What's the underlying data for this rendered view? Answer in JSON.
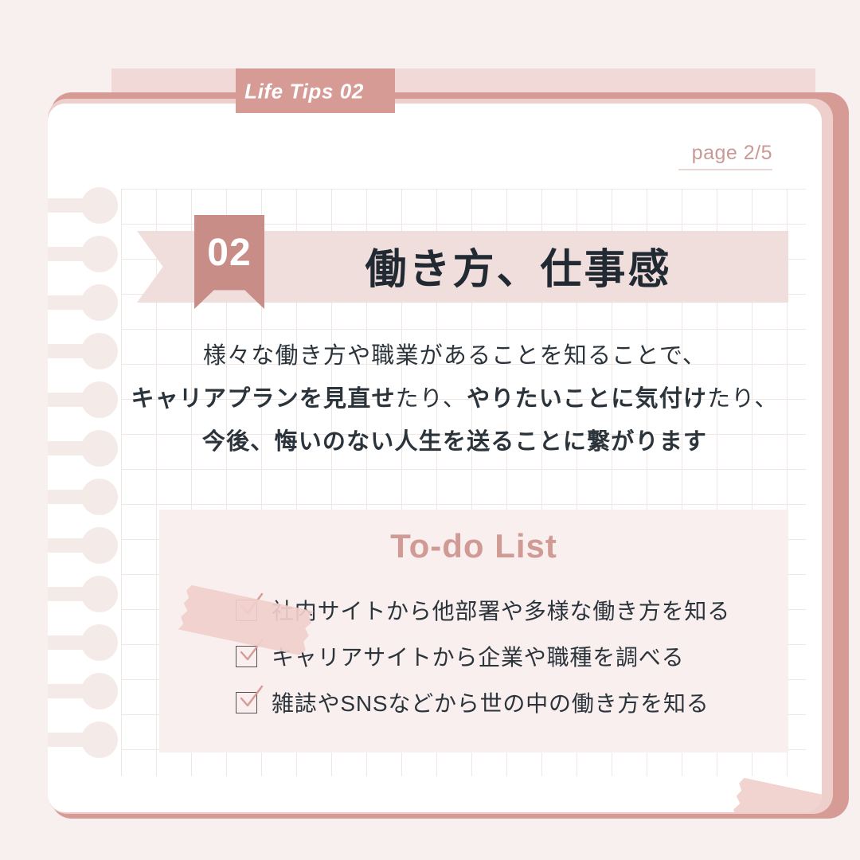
{
  "theme": {
    "background": "#f8f0ef",
    "card": "#ffffff",
    "accent_dark": "#d79b96",
    "accent_mid": "#c98d88",
    "accent_light": "#f0d9d6",
    "ribbon": "#f0dedc",
    "panel": "#f9efee",
    "tape": "#f0cfcb",
    "text_dark": "#2b333b",
    "grid_line": "#eee3e1"
  },
  "tabs": [
    {
      "label": "",
      "active": false
    },
    {
      "label": "Life Tips 02",
      "active": true
    },
    {
      "label": "",
      "active": false
    },
    {
      "label": "",
      "active": false
    },
    {
      "label": "",
      "active": false
    }
  ],
  "header": {
    "page_indicator": "page 2/5"
  },
  "ribbon": {
    "number": "02",
    "title": "働き方、仕事感"
  },
  "body": {
    "lines": [
      [
        {
          "text": "様々な働き方や職業があることを知ることで、",
          "bold": false
        }
      ],
      [
        {
          "text": "キャリアプランを見直せ",
          "bold": true
        },
        {
          "text": "たり、",
          "bold": false
        },
        {
          "text": "やりたいことに気付け",
          "bold": true
        },
        {
          "text": "たり、",
          "bold": false
        }
      ],
      [
        {
          "text": "今後、悔いのない人生を送ることに繋がります",
          "bold": true
        }
      ]
    ]
  },
  "todo": {
    "title": "To-do List",
    "items": [
      {
        "checked": true,
        "label": "社内サイトから他部署や多様な働き方を知る"
      },
      {
        "checked": true,
        "label": "キャリアサイトから企業や職種を調べる"
      },
      {
        "checked": true,
        "label": "雑誌やSNSなどから世の中の働き方を知る"
      }
    ]
  },
  "decor": {
    "binding_hole_count": 12,
    "tape_count": 2
  }
}
